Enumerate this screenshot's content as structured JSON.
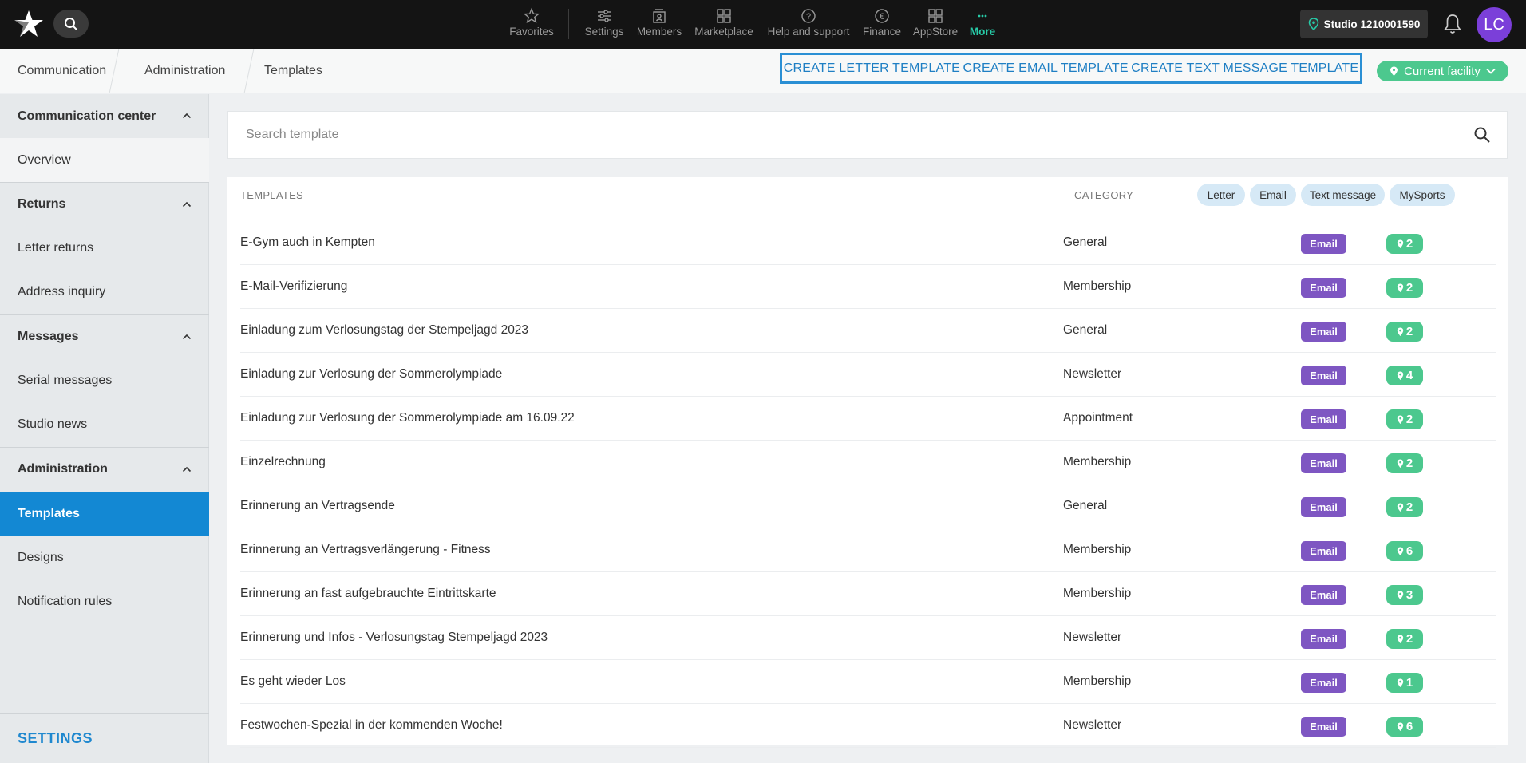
{
  "topbar": {
    "nav": [
      {
        "label": "Favorites",
        "icon": "star-icon"
      },
      {
        "label": "Settings",
        "icon": "sliders-icon"
      },
      {
        "label": "Members",
        "icon": "members-icon"
      },
      {
        "label": "Marketplace",
        "icon": "grid-icon"
      },
      {
        "label": "Help and support",
        "icon": "help-icon"
      },
      {
        "label": "Finance",
        "icon": "euro-icon"
      },
      {
        "label": "AppStore",
        "icon": "appstore-icon"
      },
      {
        "label": "More",
        "icon": "more-icon"
      }
    ],
    "studio": "Studio 1210001590",
    "avatar": "LC"
  },
  "breadcrumb": [
    "Communication",
    "Administration",
    "Templates"
  ],
  "actions": [
    "CREATE LETTER TEMPLATE",
    "CREATE EMAIL TEMPLATE",
    "CREATE TEXT MESSAGE TEMPLATE"
  ],
  "facility": "Current facility",
  "sidebar": {
    "communication_center": "Communication center",
    "overview": "Overview",
    "returns": "Returns",
    "letter_returns": "Letter returns",
    "address_inquiry": "Address inquiry",
    "messages": "Messages",
    "serial_messages": "Serial messages",
    "studio_news": "Studio news",
    "administration": "Administration",
    "templates": "Templates",
    "designs": "Designs",
    "notification_rules": "Notification rules",
    "settings": "SETTINGS"
  },
  "search": {
    "placeholder": "Search template"
  },
  "table": {
    "col_templates": "TEMPLATES",
    "col_category": "CATEGORY",
    "filters": [
      "Letter",
      "Email",
      "Text message",
      "MySports"
    ],
    "rows": [
      {
        "name": "E-Gym auch in Kempten",
        "category": "General",
        "type": "Email",
        "locations": "2"
      },
      {
        "name": "E-Mail-Verifizierung",
        "category": "Membership",
        "type": "Email",
        "locations": "2"
      },
      {
        "name": "Einladung zum Verlosungstag der Stempeljagd 2023",
        "category": "General",
        "type": "Email",
        "locations": "2"
      },
      {
        "name": "Einladung zur Verlosung der Sommerolympiade",
        "category": "Newsletter",
        "type": "Email",
        "locations": "4"
      },
      {
        "name": "Einladung zur Verlosung der Sommerolympiade am 16.09.22",
        "category": "Appointment",
        "type": "Email",
        "locations": "2"
      },
      {
        "name": "Einzelrechnung",
        "category": "Membership",
        "type": "Email",
        "locations": "2"
      },
      {
        "name": "Erinnerung an Vertragsende",
        "category": "General",
        "type": "Email",
        "locations": "2"
      },
      {
        "name": "Erinnerung an Vertragsverlängerung - Fitness",
        "category": "Membership",
        "type": "Email",
        "locations": "6"
      },
      {
        "name": "Erinnerung an fast aufgebrauchte Eintrittskarte",
        "category": "Membership",
        "type": "Email",
        "locations": "3"
      },
      {
        "name": "Erinnerung und Infos - Verlosungstag Stempeljagd 2023",
        "category": "Newsletter",
        "type": "Email",
        "locations": "2"
      },
      {
        "name": "Es geht wieder Los",
        "category": "Membership",
        "type": "Email",
        "locations": "1"
      },
      {
        "name": "Festwochen-Spezial in der kommenden Woche!",
        "category": "Newsletter",
        "type": "Email",
        "locations": "6"
      }
    ]
  },
  "colors": {
    "accent": "#1388d3",
    "email_badge": "#7e56c2",
    "location_badge": "#4cc88e",
    "more_active": "#27c9a6"
  }
}
